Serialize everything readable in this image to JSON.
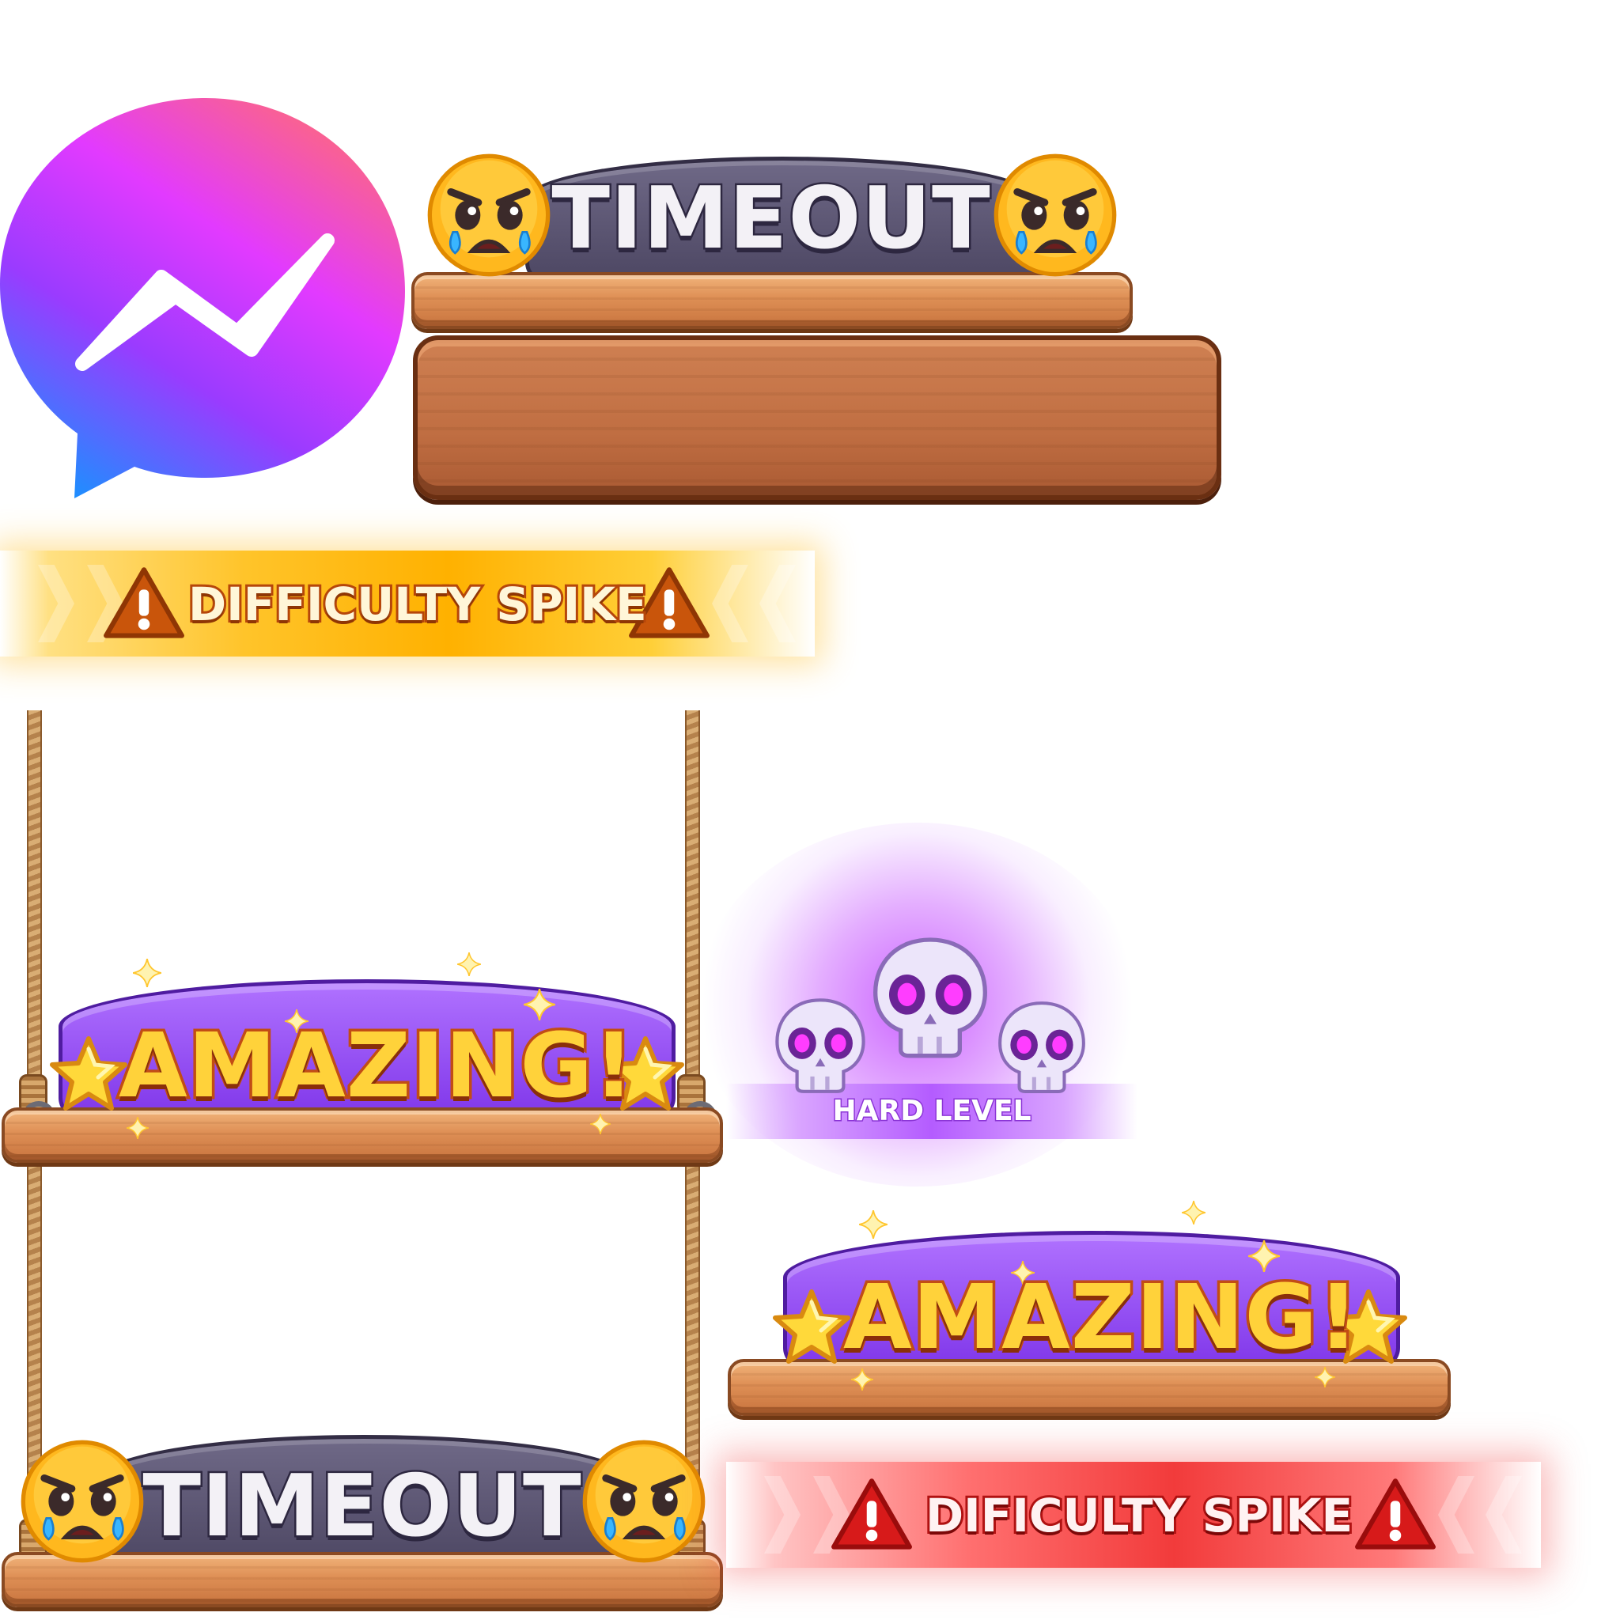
{
  "messenger": {
    "icon": "messenger-logo-icon",
    "gradient": [
      "#ff5f8a",
      "#a233ff",
      "#1b8cff"
    ]
  },
  "timeout_top": {
    "label": "TIMEOUT",
    "left_emoji": "angry-crying-face-icon",
    "right_emoji": "angry-crying-face-icon"
  },
  "wood_panel": {
    "icon": "wooden-panel"
  },
  "banner_yellow": {
    "label": "DIFFICULTY SPIKE",
    "icon": "warning-triangle-icon",
    "color": "#ffb100"
  },
  "swing_amazing": {
    "label": "AMAZING!",
    "icon": "star-icon"
  },
  "swing_timeout": {
    "label": "TIMEOUT"
  },
  "hard_level": {
    "label": "HARD LEVEL",
    "icon": "skull-icon",
    "glow_color": "#b45cff"
  },
  "amazing_plain": {
    "label": "AMAZING!"
  },
  "banner_red": {
    "label": "DIFICULTY SPIKE",
    "icon": "warning-triangle-icon",
    "color": "#f23b3b"
  }
}
